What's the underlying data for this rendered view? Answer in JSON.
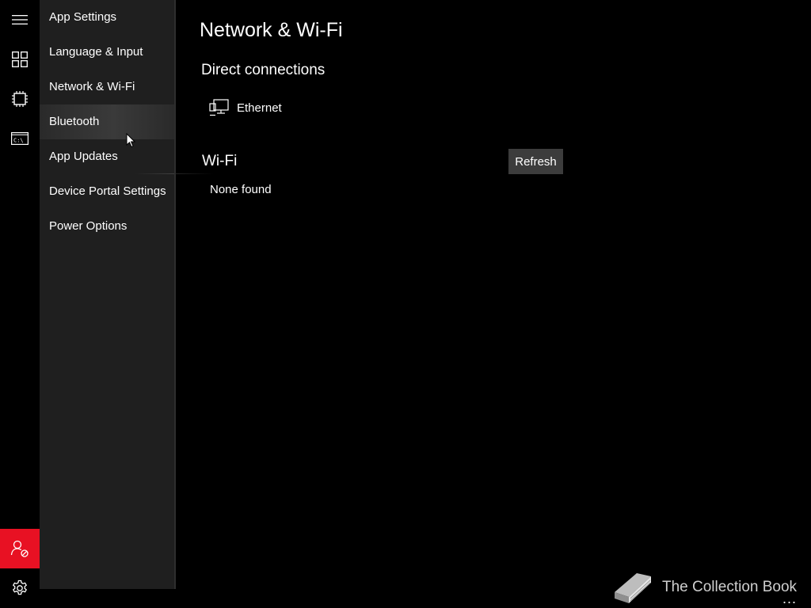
{
  "rail": {
    "icons": [
      "hamburger-icon",
      "apps-grid-icon",
      "processor-icon",
      "command-prompt-icon",
      "user-blocked-icon",
      "gear-icon"
    ],
    "user_button_color": "#e81123"
  },
  "menu": {
    "items": [
      {
        "label": "App Settings"
      },
      {
        "label": "Language & Input"
      },
      {
        "label": "Network & Wi-Fi"
      },
      {
        "label": "Bluetooth"
      },
      {
        "label": "App Updates"
      },
      {
        "label": "Device Portal Settings"
      },
      {
        "label": "Power Options"
      }
    ],
    "hovered": "Bluetooth"
  },
  "main": {
    "title": "Network & Wi-Fi",
    "direct_connections": {
      "heading": "Direct connections",
      "items": [
        {
          "label": "Ethernet",
          "icon": "ethernet-icon"
        }
      ]
    },
    "wifi": {
      "heading": "Wi-Fi",
      "refresh_label": "Refresh",
      "status": "None found"
    }
  },
  "watermark": {
    "text": "The Collection Book",
    "icon": "book-icon"
  },
  "overflow_label": "..."
}
